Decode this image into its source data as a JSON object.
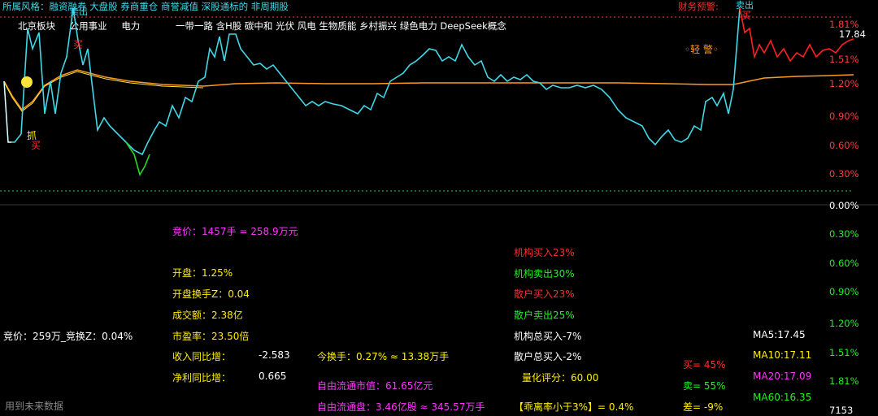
{
  "header": {
    "style_line": "所属风格：融资融券 大盘股 券商重仓 商誉减值 深股通标的 非周期股",
    "concept_tags": [
      "北京板块",
      "公用事业",
      "电力",
      "一带一路 含H股 碳中和 光伏 风电 生物质能 乡村振兴 绿色电力 DeepSeek概念"
    ],
    "risk_warning": "财务预警:"
  },
  "price_axis": {
    "top_labels": [
      "1.81%",
      "17.84",
      "1.51%",
      "1.20%",
      "0.90%",
      "0.60%",
      "0.30%",
      "0.00%"
    ],
    "bottom_labels": [
      "0.30%",
      "0.60%",
      "0.90%",
      "1.20%",
      "1.51%",
      "1.81%",
      "7153"
    ]
  },
  "markers": {
    "grab": "抓",
    "buy_left": "买",
    "sell_top_left": "卖出",
    "buy_top_left": "买",
    "sell_top_right": "卖出",
    "buy_top_right": "买",
    "warning": "◦轻 警◦"
  },
  "stats": {
    "auction": "竞价：1457手 = 258.9万元",
    "open": "开盘：1.25%",
    "open_turnover": "开盘换手Z：0.04",
    "volume": "成交额：2.38亿",
    "pe": "市盈率：23.50倍",
    "revenue_label": "收入同比增：",
    "revenue_value": "-2.583",
    "profit_label": "净利同比增：",
    "profit_value": "0.665",
    "auction_left": "竞价：259万_竞换Z：0.04%",
    "future_data": "用到未来数据",
    "turnover_now": "今换手：0.27% ≈ 13.38万手",
    "float_value": "自由流通市值：61.65亿元",
    "float_shares": "自由流通盘：3.46亿股 ≈ 345.57万手",
    "inst_buy": "机构买入23%",
    "inst_sell": "机构卖出30%",
    "retail_buy": "散户买入23%",
    "retail_sell": "散户卖出25%",
    "inst_total": "机构总买入-7%",
    "retail_total": "散户总买入-2%",
    "quant_score": "量化评分：60.00",
    "deviation": "【乖离率小于3%】= 0.4%",
    "buy_pct": "买= 45%",
    "sell_pct": "卖= 55%",
    "diff_pct": "差= -9%",
    "ma5": "MA5:17.45",
    "ma10": "MA10:17.11",
    "ma20": "MA20:17.09",
    "ma60": "MA60:16.35"
  },
  "colors": {
    "price_line": "#3fd9e6",
    "price_line_high": "#ff2020",
    "price_line_low": "#22dd22",
    "avg_line": "#ff9922",
    "avg_line_alt": "#ffe23a",
    "grid_red": "#ff3a3a",
    "grid_green": "#22cc44"
  }
}
